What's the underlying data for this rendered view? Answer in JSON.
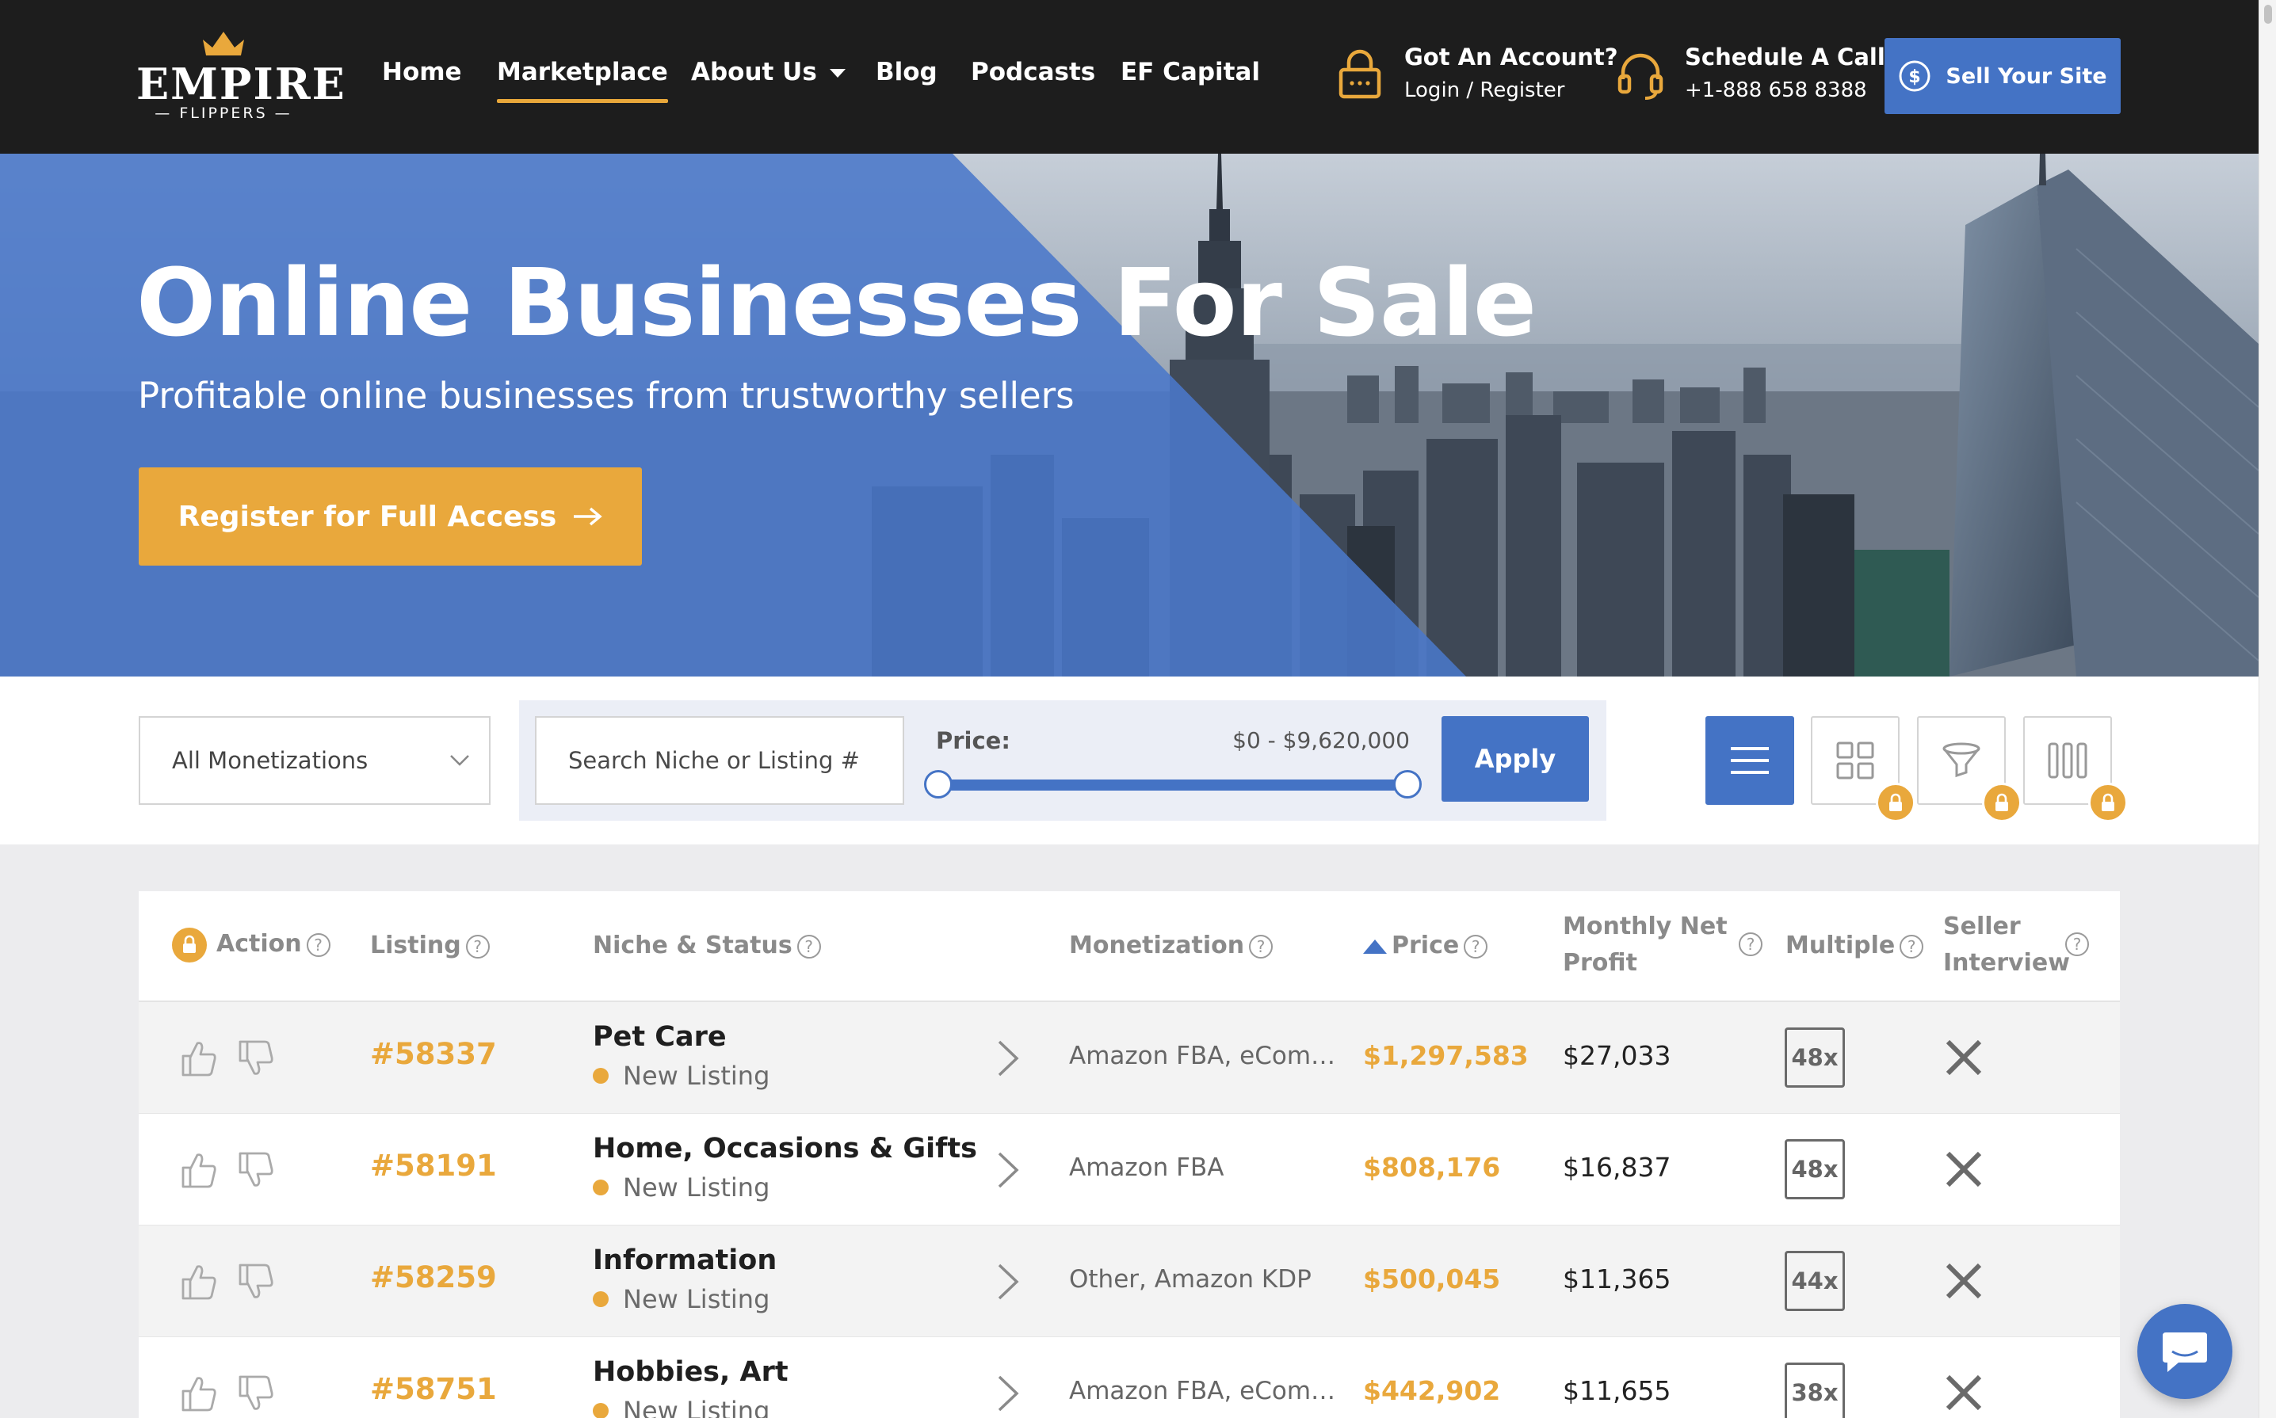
{
  "header": {
    "logo": {
      "word": "EMPIRE",
      "sub": "— FLIPPERS —"
    },
    "nav": [
      {
        "label": "Home"
      },
      {
        "label": "Marketplace",
        "active": true
      },
      {
        "label": "About Us",
        "has_dropdown": true
      },
      {
        "label": "Blog"
      },
      {
        "label": "Podcasts"
      },
      {
        "label": "EF Capital"
      }
    ],
    "account": {
      "title": "Got An Account?",
      "subtitle": "Login / Register",
      "icon": "lock-icon"
    },
    "call": {
      "title": "Schedule A Call",
      "subtitle": "+1-888 658 8388",
      "icon": "headset-icon"
    },
    "sell_button": {
      "label": "Sell Your Site",
      "icon": "dollar-circle-icon"
    }
  },
  "hero": {
    "title": "Online Businesses For Sale",
    "subtitle": "Profitable online businesses from trustworthy sellers",
    "cta": "Register for Full Access",
    "cta_icon": "arrow-right-icon"
  },
  "filters": {
    "monetization_selected": "All Monetizations",
    "search_placeholder": "Search Niche or Listing #",
    "price_label": "Price:",
    "price_range": "$0 - $9,620,000",
    "price_min_fraction": 0,
    "price_max_fraction": 1,
    "apply_label": "Apply",
    "views": [
      {
        "icon": "list-view-icon",
        "active": true,
        "locked": false
      },
      {
        "icon": "grid-view-icon",
        "active": false,
        "locked": true
      },
      {
        "icon": "funnel-icon",
        "active": false,
        "locked": true
      },
      {
        "icon": "columns-icon",
        "active": false,
        "locked": true
      }
    ]
  },
  "table": {
    "headers": {
      "action": "Action",
      "listing": "Listing",
      "niche": "Niche & Status",
      "monetization": "Monetization",
      "price": "Price",
      "profit_line1": "Monthly Net",
      "profit_line2": "Profit",
      "multiple": "Multiple",
      "interview_line1": "Seller",
      "interview_line2": "Interview"
    },
    "sorted_by": "price",
    "sort_direction": "ascending",
    "rows": [
      {
        "id": "#58337",
        "niche": "Pet Care",
        "status": "New Listing",
        "monetization": "Amazon FBA, eComme...",
        "price": "$1,297,583",
        "profit": "$27,033",
        "multiple": "48x",
        "seller_interview": false
      },
      {
        "id": "#58191",
        "niche": "Home, Occasions & Gifts",
        "status": "New Listing",
        "monetization": "Amazon FBA",
        "price": "$808,176",
        "profit": "$16,837",
        "multiple": "48x",
        "seller_interview": false
      },
      {
        "id": "#58259",
        "niche": "Information",
        "status": "New Listing",
        "monetization": "Other, Amazon KDP",
        "price": "$500,045",
        "profit": "$11,365",
        "multiple": "44x",
        "seller_interview": false
      },
      {
        "id": "#58751",
        "niche": "Hobbies, Art",
        "status": "New Listing",
        "monetization": "Amazon FBA, eComme...",
        "price": "$442,902",
        "profit": "$11,655",
        "multiple": "38x",
        "seller_interview": false
      }
    ]
  },
  "colors": {
    "accent_orange": "#e9a83c",
    "brand_blue": "#4473c5",
    "header_bg": "#1d1d1d"
  },
  "chat": {
    "icon": "chat-bubble-icon"
  }
}
